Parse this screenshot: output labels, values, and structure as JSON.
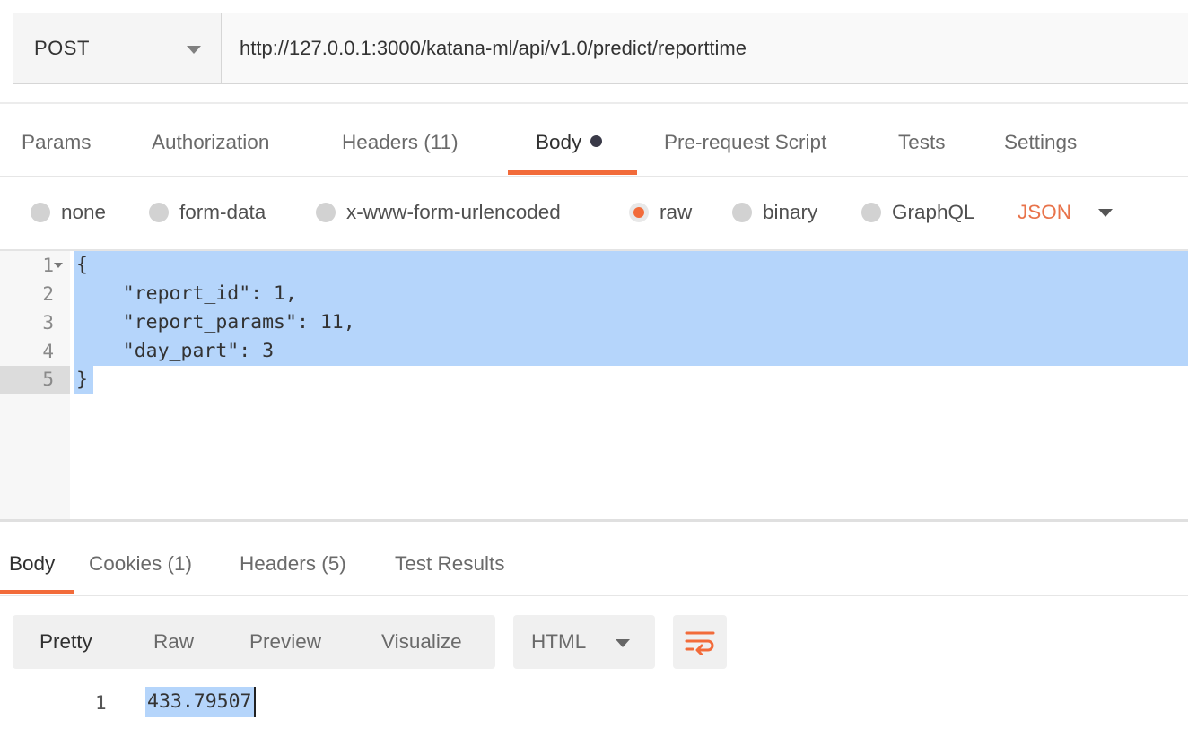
{
  "request": {
    "method": "POST",
    "url": "http://127.0.0.1:3000/katana-ml/api/v1.0/predict/reporttime"
  },
  "request_tabs": [
    {
      "label": "Params"
    },
    {
      "label": "Authorization"
    },
    {
      "label": "Headers (11)"
    },
    {
      "label": "Body",
      "active": true,
      "has_dot": true
    },
    {
      "label": "Pre-request Script"
    },
    {
      "label": "Tests"
    },
    {
      "label": "Settings"
    }
  ],
  "body_modes": [
    {
      "label": "none"
    },
    {
      "label": "form-data"
    },
    {
      "label": "x-www-form-urlencoded"
    },
    {
      "label": "raw",
      "selected": true
    },
    {
      "label": "binary"
    },
    {
      "label": "GraphQL"
    }
  ],
  "body_format": "JSON",
  "editor": {
    "line_numbers": [
      "1",
      "2",
      "3",
      "4",
      "5"
    ],
    "lines": [
      "{",
      "    \"report_id\": 1,",
      "    \"report_params\": 11,",
      "    \"day_part\": 3",
      "}"
    ]
  },
  "response_tabs": [
    {
      "label": "Body",
      "active": true
    },
    {
      "label": "Cookies (1)"
    },
    {
      "label": "Headers (5)"
    },
    {
      "label": "Test Results"
    }
  ],
  "view_modes": [
    {
      "label": "Pretty",
      "active": true
    },
    {
      "label": "Raw"
    },
    {
      "label": "Preview"
    },
    {
      "label": "Visualize"
    }
  ],
  "response_language": "HTML",
  "response": {
    "line_number": "1",
    "value": "433.79507"
  },
  "colors": {
    "accent": "#f26b3a",
    "selection": "#b5d5fb"
  }
}
